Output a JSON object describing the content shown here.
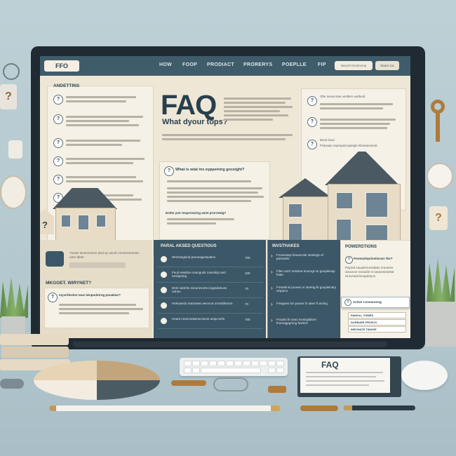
{
  "nav": {
    "logo": "FFO",
    "items": [
      "HOW",
      "FOOP",
      "PRODIACT",
      "PRORERYS",
      "POEPLLE",
      "FIP"
    ],
    "search_placeholder": "Seacrh fonstrocnp",
    "search_button": "Seacn ioc"
  },
  "hero": {
    "title": "FAQ",
    "subtitle": "What dyour tops?"
  },
  "left_panel": {
    "title": "ANDETTINS",
    "bubble_text": "Youise Ieneromcion aivd vp oeroin Hovsreseeniec orter tdeto"
  },
  "mid_question": {
    "title": "What is wiat ins eyppeinirg goceight?",
    "subheading": "Enthe yoir Iesperearing asiet prorrewig?"
  },
  "bottom_left": {
    "title": "MKGOET. WIRYNET?",
    "question": "mysrtileslon taue iwnpudstrng pouakiar?"
  },
  "dark_section": {
    "title": "PARAL AKSED QUESTIOUS",
    "rows": [
      {
        "text": "Wrohseglood paroeagessplans",
        "price": "700"
      },
      {
        "text": "Feuit Heatline nosngnds rosnrslipt and rentspning",
        "price": "100"
      },
      {
        "text": "Dreit sarshtn ssoonevorts iraypuliseuss rotneo",
        "price": "70"
      },
      {
        "text": "Hrelvaesls ssesrases wecnurt onrantilionnn",
        "price": "70"
      },
      {
        "text": "Hearit rosorvsolamecnsont aeipccetfu",
        "price": "700"
      }
    ]
  },
  "investments": {
    "title": "INVSTHAKES",
    "rows": [
      "Fronwnarp fonuecntie seoinrgs of paninarts",
      "Filen oon't vrisnine troorogt on goupleinap feats",
      "Fnswlenis pcoess sr sereng fe goupleinary orspeno",
      "Fnwgoes fon pouse fo ainer fi arolng",
      "Frsosts fe sans mvsiupldsrei thoreagpgreng favtrts?"
    ]
  },
  "properties": {
    "title": "POWERSTIONS",
    "question": "Poneanlopriestiecarr the?",
    "body": "Payrait sauaeirsonsdatto nreoeser aeuovoe sceauite in saraomiasetat Hnovseal Doupartyos",
    "button": "Active Lonearonng",
    "links": [
      "PAMOLL THWES",
      "DUPBUEE FRVECG",
      "INEOHATE TINGGE"
    ]
  },
  "right_panel": {
    "q1": "Ohe Ivessorate vestlers eaitheid",
    "q2": "Beoit lioun",
    "q2_body": "Prdusaie anprspamopeigte kiteasesonral"
  },
  "desk": {
    "document_title": "FAQ"
  },
  "colors": {
    "nav": "#3f5c6b",
    "screen_bg": "#efe7d6",
    "dark_panel": "#3c5767",
    "accent_brown": "#b07a3a",
    "wall": "#b4c8cf"
  }
}
